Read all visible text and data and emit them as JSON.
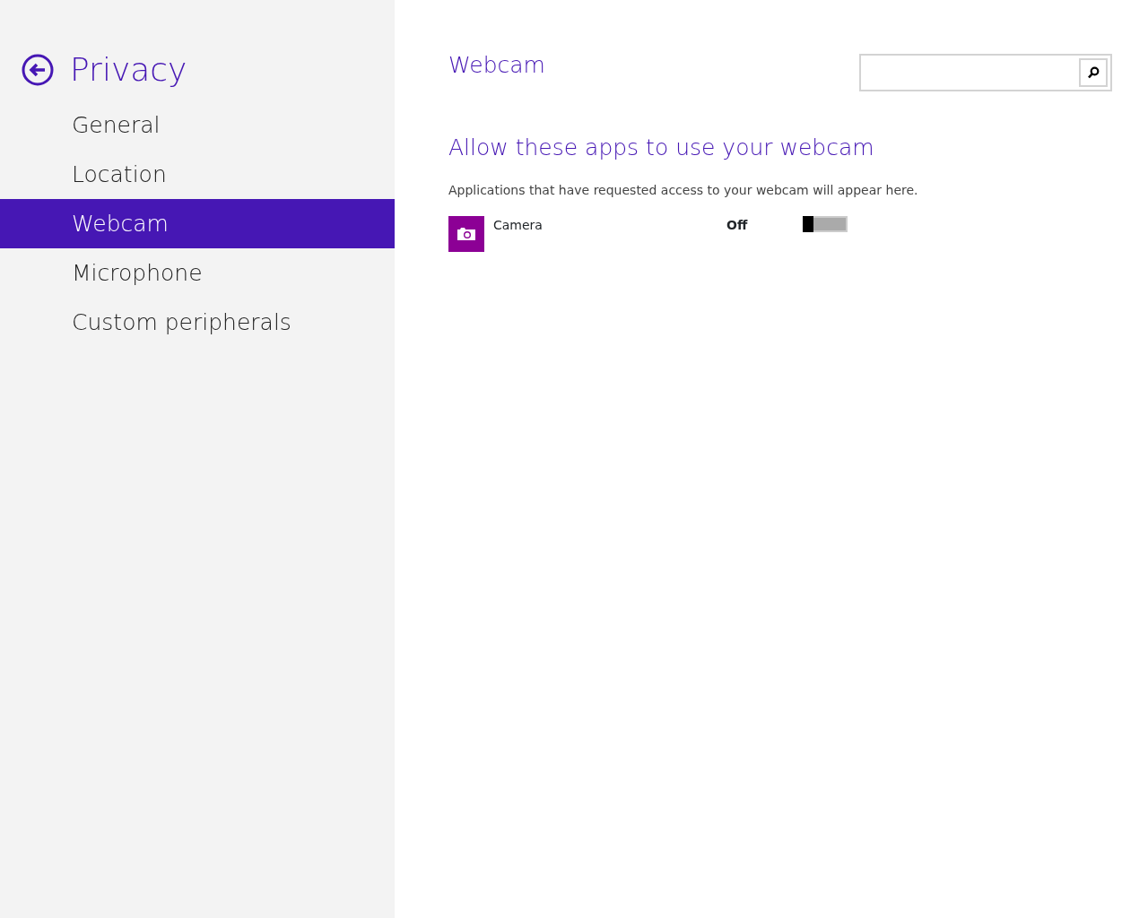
{
  "sidebar": {
    "title": "Privacy",
    "items": [
      {
        "label": "General",
        "selected": false
      },
      {
        "label": "Location",
        "selected": false
      },
      {
        "label": "Webcam",
        "selected": true
      },
      {
        "label": "Microphone",
        "selected": false
      },
      {
        "label": "Custom peripherals",
        "selected": false
      }
    ]
  },
  "main": {
    "title": "Webcam",
    "heading": "Allow these apps to use your webcam",
    "description": "Applications that have requested access to your webcam will appear here.",
    "apps": [
      {
        "name": "Camera",
        "state_label": "Off",
        "on": false
      }
    ]
  }
}
